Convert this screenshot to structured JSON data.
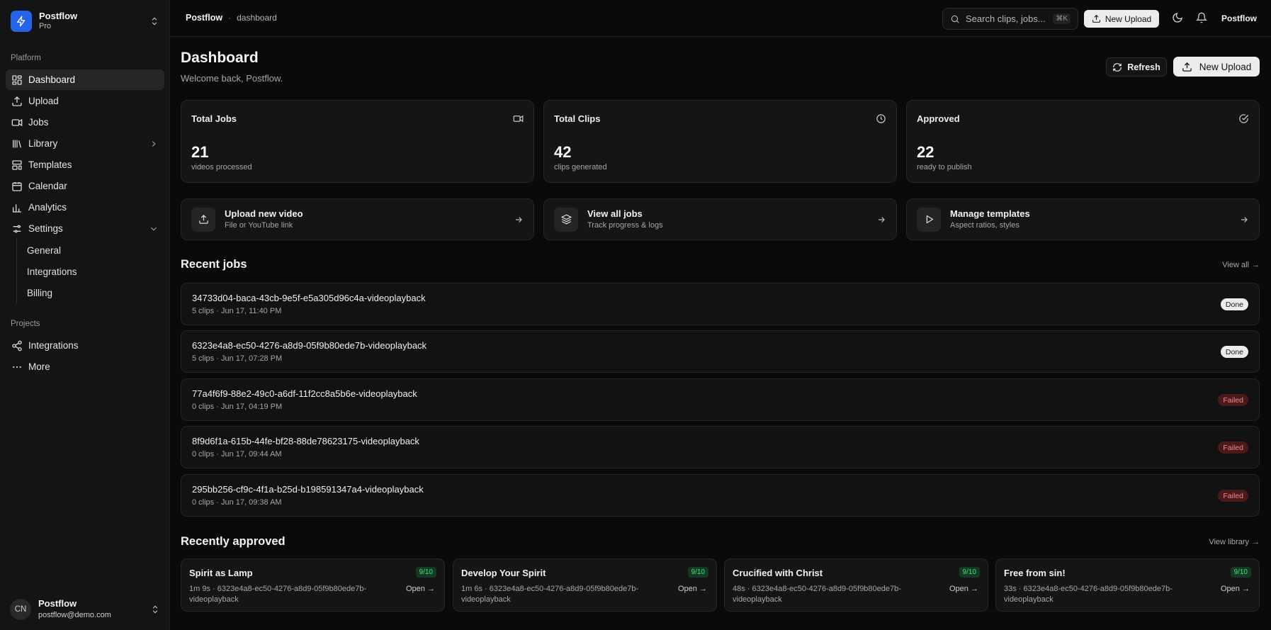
{
  "workspace": {
    "name": "Postflow",
    "plan": "Pro"
  },
  "sidebar": {
    "platform_label": "Platform",
    "items": [
      {
        "label": "Dashboard",
        "icon": "dashboard-icon"
      },
      {
        "label": "Upload",
        "icon": "upload-icon"
      },
      {
        "label": "Jobs",
        "icon": "video-icon"
      },
      {
        "label": "Library",
        "icon": "library-icon"
      },
      {
        "label": "Templates",
        "icon": "templates-icon"
      },
      {
        "label": "Calendar",
        "icon": "calendar-icon"
      },
      {
        "label": "Analytics",
        "icon": "chart-icon"
      },
      {
        "label": "Settings",
        "icon": "settings-icon"
      }
    ],
    "settings_sub": [
      "General",
      "Integrations",
      "Billing"
    ],
    "projects_label": "Projects",
    "projects": [
      {
        "label": "Integrations",
        "icon": "share-icon"
      },
      {
        "label": "More",
        "icon": "more-icon"
      }
    ],
    "user": {
      "initials": "CN",
      "name": "Postflow",
      "email": "postflow@demo.com"
    }
  },
  "topbar": {
    "breadcrumb_root": "Postflow",
    "breadcrumb_sep": "·",
    "breadcrumb_page": "dashboard",
    "search_placeholder": "Search clips, jobs...",
    "search_shortcut": "⌘K",
    "upload_label": "New Upload",
    "user_label": "Postflow"
  },
  "header": {
    "title": "Dashboard",
    "subtitle": "Welcome back, Postflow.",
    "refresh_label": "Refresh",
    "upload_label": "New Upload"
  },
  "stats": [
    {
      "title": "Total Jobs",
      "value": "21",
      "desc": "videos processed",
      "icon": "video-icon"
    },
    {
      "title": "Total Clips",
      "value": "42",
      "desc": "clips generated",
      "icon": "clock-icon"
    },
    {
      "title": "Approved",
      "value": "22",
      "desc": "ready to publish",
      "icon": "check-circle-icon"
    }
  ],
  "actions": [
    {
      "title": "Upload new video",
      "sub": "File or YouTube link",
      "icon": "upload-icon"
    },
    {
      "title": "View all jobs",
      "sub": "Track progress & logs",
      "icon": "layers-icon"
    },
    {
      "title": "Manage templates",
      "sub": "Aspect ratios, styles",
      "icon": "play-icon"
    }
  ],
  "recent_jobs": {
    "title": "Recent jobs",
    "view_all": "View all",
    "arrow": "→",
    "rows": [
      {
        "name": "34733d04-baca-43cb-9e5f-e5a305d96c4a-videoplayback",
        "meta": "5 clips · Jun 17, 11:40 PM",
        "status": "Done"
      },
      {
        "name": "6323e4a8-ec50-4276-a8d9-05f9b80ede7b-videoplayback",
        "meta": "5 clips · Jun 17, 07:28 PM",
        "status": "Done"
      },
      {
        "name": "77a4f6f9-88e2-49c0-a6df-11f2cc8a5b6e-videoplayback",
        "meta": "0 clips · Jun 17, 04:19 PM",
        "status": "Failed"
      },
      {
        "name": "8f9d6f1a-615b-44fe-bf28-88de78623175-videoplayback",
        "meta": "0 clips · Jun 17, 09:44 AM",
        "status": "Failed"
      },
      {
        "name": "295bb256-cf9c-4f1a-b25d-b198591347a4-videoplayback",
        "meta": "0 clips · Jun 17, 09:38 AM",
        "status": "Failed"
      }
    ]
  },
  "recently_approved": {
    "title": "Recently approved",
    "view_library": "View library",
    "arrow": "→",
    "cards": [
      {
        "title": "Spirit as Lamp",
        "score": "9/10",
        "meta": "1m 9s · 6323e4a8-ec50-4276-a8d9-05f9b80ede7b-videoplayback",
        "open": "Open →"
      },
      {
        "title": "Develop Your Spirit",
        "score": "9/10",
        "meta": "1m 6s · 6323e4a8-ec50-4276-a8d9-05f9b80ede7b-videoplayback",
        "open": "Open →"
      },
      {
        "title": "Crucified with Christ",
        "score": "9/10",
        "meta": "48s · 6323e4a8-ec50-4276-a8d9-05f9b80ede7b-videoplayback",
        "open": "Open →"
      },
      {
        "title": "Free from sin!",
        "score": "9/10",
        "meta": "33s · 6323e4a8-ec50-4276-a8d9-05f9b80ede7b-videoplayback",
        "open": "Open →"
      }
    ]
  },
  "colors": {
    "accent": "#2563eb",
    "done_badge": "#ececec",
    "failed_badge": "#4a1a1a",
    "score_green": "#4ade80"
  }
}
